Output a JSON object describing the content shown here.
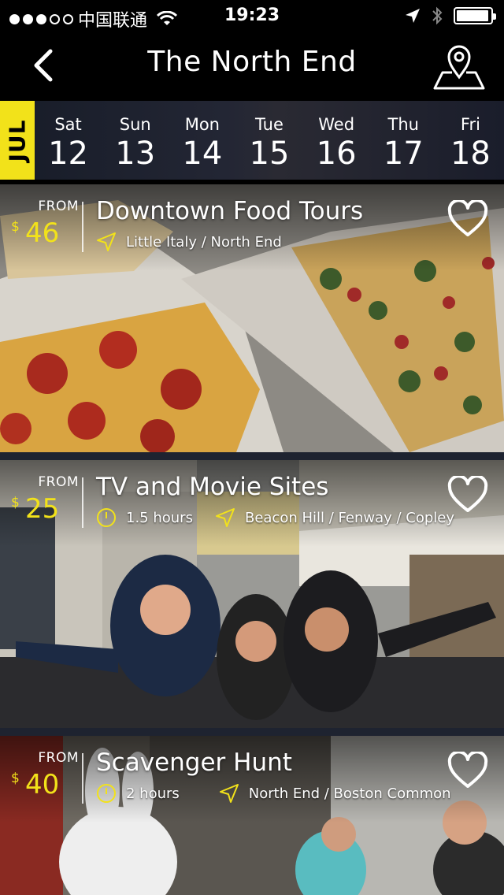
{
  "status_bar": {
    "carrier": "中国联通",
    "time": "19:23",
    "signal_dots_filled": 3,
    "signal_dots_total": 5,
    "battery_level": 0.95
  },
  "nav": {
    "title": "The North End",
    "back_icon": "chevron-left-icon",
    "map_icon": "map-pin-icon"
  },
  "date_strip": {
    "month": "JUL",
    "days": [
      {
        "dow": "Sat",
        "num": "12"
      },
      {
        "dow": "Sun",
        "num": "13"
      },
      {
        "dow": "Mon",
        "num": "14"
      },
      {
        "dow": "Tue",
        "num": "15"
      },
      {
        "dow": "Wed",
        "num": "16"
      },
      {
        "dow": "Thu",
        "num": "17"
      },
      {
        "dow": "Fri",
        "num": "18"
      }
    ]
  },
  "tours": [
    {
      "from_label": "FROM",
      "currency": "$",
      "price": "46",
      "title": "Downtown Food Tours",
      "duration": "",
      "location": "Little Italy / North End"
    },
    {
      "from_label": "FROM",
      "currency": "$",
      "price": "25",
      "title": "TV and Movie Sites",
      "duration": "1.5 hours",
      "location": "Beacon Hill / Fenway / Copley"
    },
    {
      "from_label": "FROM",
      "currency": "$",
      "price": "40",
      "title": "Scavenger Hunt",
      "duration": "2 hours",
      "location": "North End / Boston Common"
    }
  ],
  "colors": {
    "accent": "#f2e21a",
    "background": "#000000",
    "date_strip": "#1e2330"
  }
}
